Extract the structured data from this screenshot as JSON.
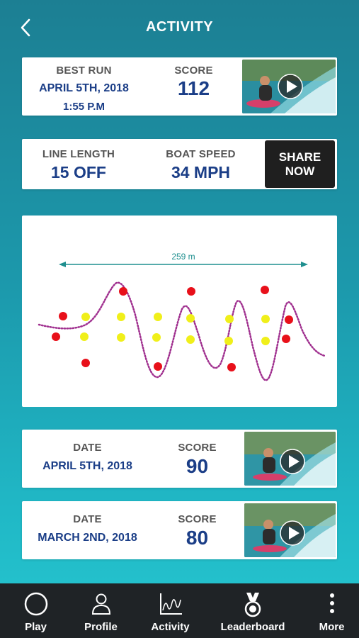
{
  "header": {
    "title": "ACTIVITY",
    "back_icon": "chevron-left-icon"
  },
  "best_run": {
    "label": "BEST RUN",
    "date": "APRIL 5TH, 2018",
    "time": "1:55 P.M",
    "score_label": "SCORE",
    "score": "112"
  },
  "stats": {
    "line_length_label": "LINE LENGTH",
    "line_length": "15 OFF",
    "boat_speed_label": "BOAT SPEED",
    "boat_speed": "34 MPH",
    "share_line1": "SHARE",
    "share_line2": "NOW"
  },
  "path_chart": {
    "distance_label": "259 m"
  },
  "runs": [
    {
      "date_label": "DATE",
      "date": "APRIL 5TH, 2018",
      "score_label": "SCORE",
      "score": "90"
    },
    {
      "date_label": "DATE",
      "date": "MARCH 2ND, 2018",
      "score_label": "SCORE",
      "score": "80"
    }
  ],
  "nav": [
    {
      "label": "Play",
      "icon": "circle-icon"
    },
    {
      "label": "Profile",
      "icon": "person-icon"
    },
    {
      "label": "Activity",
      "icon": "chart-icon"
    },
    {
      "label": "Leaderboard",
      "icon": "medal-icon"
    },
    {
      "label": "More",
      "icon": "more-vertical-icon"
    }
  ],
  "colors": {
    "accent_blue": "#1b3e87",
    "buoy_red": "#e8101a",
    "buoy_yellow": "#f0ef1a",
    "path_purple": "#a0308f",
    "distance_teal": "#1f8f8f"
  }
}
